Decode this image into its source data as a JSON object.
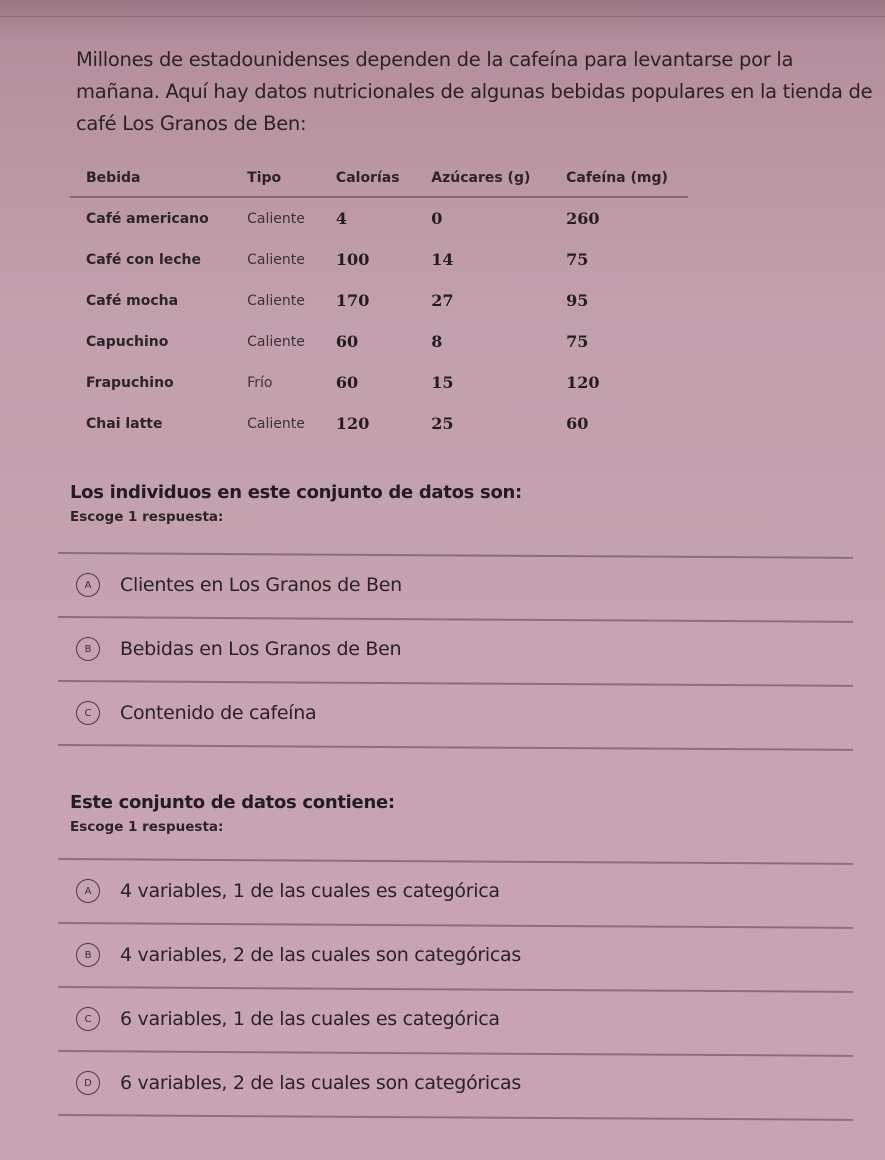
{
  "intro_text": "Millones de estadounidenses dependen de la cafeína para levantarse por la mañana. Aquí hay datos nutricionales de algunas bebidas populares en la tienda de café Los Granos de Ben:",
  "table": {
    "headers": [
      "Bebida",
      "Tipo",
      "Calorías",
      "Azúcares (g)",
      "Cafeína (mg)"
    ],
    "rows": [
      [
        "Café americano",
        "Caliente",
        "4",
        "0",
        "260"
      ],
      [
        "Café con leche",
        "Caliente",
        "100",
        "14",
        "75"
      ],
      [
        "Café mocha",
        "Caliente",
        "170",
        "27",
        "95"
      ],
      [
        "Capuchino",
        "Caliente",
        "60",
        "8",
        "75"
      ],
      [
        "Frapuchino",
        "Frío",
        "60",
        "15",
        "120"
      ],
      [
        "Chai latte",
        "Caliente",
        "120",
        "25",
        "60"
      ]
    ]
  },
  "questions": [
    {
      "title": "Los individuos en este conjunto de datos son:",
      "instruction": "Escoge 1 respuesta:",
      "options": [
        {
          "letter": "A",
          "text": "Clientes en Los Granos de Ben"
        },
        {
          "letter": "B",
          "text": "Bebidas en Los Granos de Ben"
        },
        {
          "letter": "C",
          "text": "Contenido de cafeína"
        }
      ]
    },
    {
      "title": "Este conjunto de datos contiene:",
      "instruction": "Escoge 1 respuesta:",
      "options": [
        {
          "letter": "A",
          "text": "4 variables, 1 de las cuales es categórica"
        },
        {
          "letter": "B",
          "text": "4 variables, 2 de las cuales son categóricas"
        },
        {
          "letter": "C",
          "text": "6 variables, 1 de las cuales es categórica"
        },
        {
          "letter": "D",
          "text": "6 variables, 2 de las cuales son categóricas"
        }
      ]
    }
  ]
}
